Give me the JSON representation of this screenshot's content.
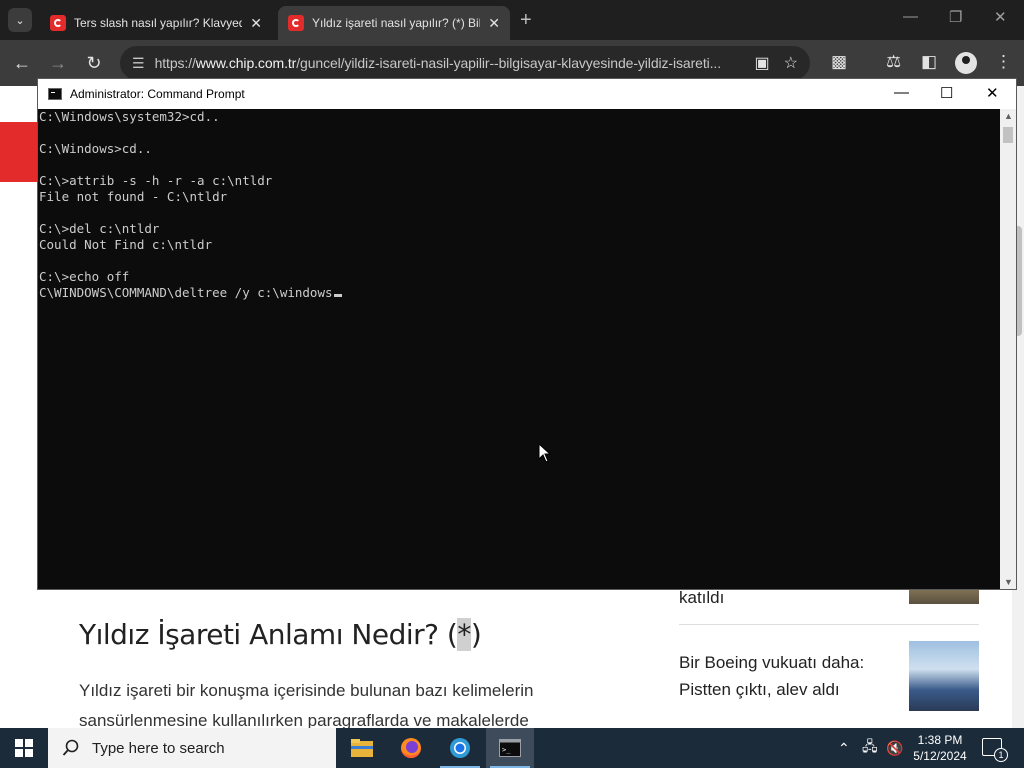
{
  "browser": {
    "tabs": [
      {
        "title": "Ters slash nasıl yapılır? Klavyede",
        "active": false
      },
      {
        "title": "Yıldız işareti nasıl yapılır? (*) Bil",
        "active": true
      }
    ],
    "url_prefix": "https://",
    "url_host": "www.chip.com.tr",
    "url_path": "/guncel/yildiz-isareti-nasil-yapilir--bilgisayar-klavyesinde-yildiz-isareti..."
  },
  "page": {
    "article_heading_prefix": "Yıldız İşareti Anlamı Nedir? (",
    "article_heading_symbol": "*",
    "article_heading_suffix": ")",
    "article_paragraph": "Yıldız işareti bir konuşma içerisinde bulunan bazı kelimelerin sansürlenmesine kullanılırken paragraflarda ve makalelerde",
    "sidebar": [
      {
        "text": "katıldı"
      },
      {
        "text": "Bir Boeing vukuatı daha: Pistten çıktı, alev aldı"
      }
    ]
  },
  "cmd": {
    "title": "Administrator: Command Prompt",
    "lines": [
      "C:\\Windows\\system32>cd..",
      "",
      "C:\\Windows>cd..",
      "",
      "C:\\>attrib -s -h -r -a c:\\ntldr",
      "File not found - C:\\ntldr",
      "",
      "C:\\>del c:\\ntldr",
      "Could Not Find c:\\ntldr",
      "",
      "C:\\>echo off",
      "C\\WINDOWS\\COMMAND\\deltree /y c:\\windows"
    ]
  },
  "taskbar": {
    "search_placeholder": "Type here to search",
    "time": "1:38 PM",
    "date": "5/12/2024",
    "notification_count": "1"
  }
}
